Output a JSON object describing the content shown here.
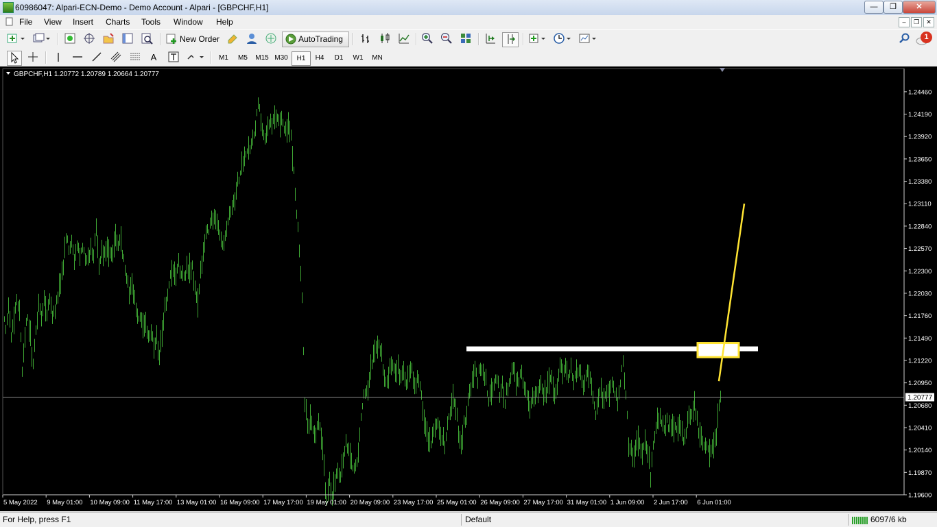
{
  "window": {
    "title": "60986047: Alpari-ECN-Demo - Demo Account - Alpari - [GBPCHF,H1]"
  },
  "menu": [
    "File",
    "View",
    "Insert",
    "Charts",
    "Tools",
    "Window",
    "Help"
  ],
  "toolbar": {
    "new_order_label": "New Order",
    "autotrading_label": "AutoTrading",
    "notification_count": "1"
  },
  "timeframes": {
    "items": [
      "M1",
      "M5",
      "M15",
      "M30",
      "H1",
      "H4",
      "D1",
      "W1",
      "MN"
    ],
    "active": "H1"
  },
  "chart": {
    "info": "GBPCHF,H1  1.20772 1.20789 1.20664 1.20777",
    "current_price_label": "1.20777",
    "price_labels": [
      "1.24460",
      "1.24190",
      "1.23920",
      "1.23650",
      "1.23380",
      "1.23110",
      "1.22840",
      "1.22570",
      "1.22300",
      "1.22030",
      "1.21760",
      "1.21490",
      "1.21220",
      "1.20950",
      "1.20680",
      "1.20410",
      "1.20140",
      "1.19870",
      "1.19600"
    ],
    "time_labels": [
      "5 May 2022",
      "9 May 01:00",
      "10 May 09:00",
      "11 May 17:00",
      "13 May 01:00",
      "16 May 09:00",
      "17 May 17:00",
      "19 May 01:00",
      "20 May 09:00",
      "23 May 17:00",
      "25 May 01:00",
      "26 May 09:00",
      "27 May 17:00",
      "31 May 01:00",
      "1 Jun 09:00",
      "2 Jun 17:00",
      "6 Jun 01:00"
    ],
    "colors": {
      "background": "#000000",
      "bars": "#3fa934",
      "axis_text": "#ffffff",
      "price_line": "#8c8c8c",
      "annotation_horizontal": "#ffffff",
      "annotation_highlight": "#ffe433"
    }
  },
  "chart_data": {
    "type": "ohlc",
    "symbol": "GBPCHF",
    "timeframe": "H1",
    "ylim": [
      1.196,
      1.2474
    ],
    "current_price": 1.20777,
    "price_path": [
      [
        0,
        1.2165
      ],
      [
        4,
        1.2185
      ],
      [
        8,
        1.216
      ],
      [
        12,
        1.219
      ],
      [
        16,
        1.215
      ],
      [
        20,
        1.2175
      ],
      [
        24,
        1.2195
      ],
      [
        28,
        1.2185
      ],
      [
        32,
        1.211
      ],
      [
        36,
        1.2155
      ],
      [
        40,
        1.217
      ],
      [
        44,
        1.215
      ],
      [
        48,
        1.2115
      ],
      [
        52,
        1.216
      ],
      [
        56,
        1.219
      ],
      [
        60,
        1.2175
      ],
      [
        64,
        1.2195
      ],
      [
        68,
        1.218
      ],
      [
        72,
        1.22
      ],
      [
        76,
        1.2175
      ],
      [
        80,
        1.2185
      ],
      [
        84,
        1.22
      ],
      [
        88,
        1.222
      ],
      [
        92,
        1.224
      ],
      [
        96,
        1.227
      ],
      [
        100,
        1.2255
      ],
      [
        104,
        1.2265
      ],
      [
        108,
        1.224
      ],
      [
        112,
        1.226
      ],
      [
        116,
        1.225
      ],
      [
        120,
        1.2265
      ],
      [
        124,
        1.224
      ],
      [
        128,
        1.2245
      ],
      [
        132,
        1.2255
      ],
      [
        136,
        1.225
      ],
      [
        140,
        1.2285
      ],
      [
        144,
        1.223
      ],
      [
        148,
        1.2255
      ],
      [
        152,
        1.2248
      ],
      [
        156,
        1.2262
      ],
      [
        160,
        1.225
      ],
      [
        164,
        1.2258
      ],
      [
        168,
        1.2272
      ],
      [
        172,
        1.2258
      ],
      [
        176,
        1.2268
      ],
      [
        180,
        1.224
      ],
      [
        184,
        1.2225
      ],
      [
        188,
        1.2205
      ],
      [
        192,
        1.2215
      ],
      [
        196,
        1.2195
      ],
      [
        200,
        1.217
      ],
      [
        204,
        1.2175
      ],
      [
        208,
        1.216
      ],
      [
        212,
        1.2168
      ],
      [
        216,
        1.215
      ],
      [
        220,
        1.2155
      ],
      [
        224,
        1.214
      ],
      [
        228,
        1.215
      ],
      [
        232,
        1.2128
      ],
      [
        236,
        1.2155
      ],
      [
        240,
        1.2185
      ],
      [
        244,
        1.22
      ],
      [
        248,
        1.222
      ],
      [
        252,
        1.2225
      ],
      [
        256,
        1.2225
      ],
      [
        260,
        1.2238
      ],
      [
        264,
        1.2222
      ],
      [
        268,
        1.2225
      ],
      [
        272,
        1.2232
      ],
      [
        276,
        1.2228
      ],
      [
        280,
        1.2232
      ],
      [
        284,
        1.221
      ],
      [
        288,
        1.2188
      ],
      [
        292,
        1.2225
      ],
      [
        296,
        1.2258
      ],
      [
        300,
        1.2275
      ],
      [
        304,
        1.228
      ],
      [
        308,
        1.2295
      ],
      [
        312,
        1.2292
      ],
      [
        316,
        1.2285
      ],
      [
        320,
        1.2275
      ],
      [
        324,
        1.226
      ],
      [
        328,
        1.2275
      ],
      [
        332,
        1.2292
      ],
      [
        336,
        1.2305
      ],
      [
        340,
        1.231
      ],
      [
        344,
        1.233
      ],
      [
        348,
        1.2342
      ],
      [
        352,
        1.2358
      ],
      [
        356,
        1.2368
      ],
      [
        360,
        1.2372
      ],
      [
        364,
        1.2378
      ],
      [
        368,
        1.2385
      ],
      [
        372,
        1.2405
      ],
      [
        376,
        1.243
      ],
      [
        380,
        1.2412
      ],
      [
        384,
        1.2398
      ],
      [
        388,
        1.2388
      ],
      [
        392,
        1.2412
      ],
      [
        396,
        1.2405
      ],
      [
        400,
        1.2418
      ],
      [
        404,
        1.2418
      ],
      [
        408,
        1.2412
      ],
      [
        412,
        1.2408
      ],
      [
        416,
        1.2402
      ],
      [
        420,
        1.24
      ],
      [
        424,
        1.239
      ],
      [
        428,
        1.235
      ],
      [
        432,
        1.23
      ],
      [
        436,
        1.226
      ],
      [
        440,
        1.22
      ],
      [
        444,
        1.2065
      ],
      [
        448,
        1.2045
      ],
      [
        452,
        1.205
      ],
      [
        456,
        1.204
      ],
      [
        460,
        1.203
      ],
      [
        464,
        1.2045
      ],
      [
        468,
        1.203
      ],
      [
        472,
        1.199
      ],
      [
        476,
        1.195
      ],
      [
        480,
        1.1975
      ],
      [
        484,
        1.196
      ],
      [
        488,
        1.1975
      ],
      [
        492,
        1.199
      ],
      [
        496,
        1.1985
      ],
      [
        500,
        1.2
      ],
      [
        504,
        1.2025
      ],
      [
        508,
        1.2015
      ],
      [
        512,
        1.2
      ],
      [
        516,
        1.199
      ],
      [
        520,
        1.2005
      ],
      [
        524,
        1.203
      ],
      [
        528,
        1.207
      ],
      [
        532,
        1.2085
      ],
      [
        536,
        1.208
      ],
      [
        540,
        1.2115
      ],
      [
        544,
        1.2125
      ],
      [
        548,
        1.214
      ],
      [
        552,
        1.2145
      ],
      [
        556,
        1.213
      ],
      [
        560,
        1.21
      ],
      [
        564,
        1.2095
      ],
      [
        568,
        1.211
      ],
      [
        572,
        1.212
      ],
      [
        576,
        1.2108
      ],
      [
        580,
        1.2115
      ],
      [
        584,
        1.21
      ],
      [
        588,
        1.2108
      ],
      [
        592,
        1.209
      ],
      [
        596,
        1.2105
      ],
      [
        600,
        1.211
      ],
      [
        604,
        1.2095
      ],
      [
        608,
        1.2098
      ],
      [
        612,
        1.209
      ],
      [
        616,
        1.206
      ],
      [
        620,
        1.204
      ],
      [
        624,
        1.203
      ],
      [
        628,
        1.202
      ],
      [
        632,
        1.2035
      ],
      [
        636,
        1.2045
      ],
      [
        640,
        1.204
      ],
      [
        644,
        1.203
      ],
      [
        648,
        1.2022
      ],
      [
        652,
        1.2045
      ],
      [
        656,
        1.206
      ],
      [
        660,
        1.2075
      ],
      [
        664,
        1.2068
      ],
      [
        668,
        1.204
      ],
      [
        672,
        1.2015
      ],
      [
        676,
        1.2045
      ],
      [
        680,
        1.206
      ],
      [
        684,
        1.2085
      ],
      [
        688,
        1.21
      ],
      [
        692,
        1.211
      ],
      [
        696,
        1.21
      ],
      [
        700,
        1.2115
      ],
      [
        704,
        1.2105
      ],
      [
        708,
        1.2095
      ],
      [
        712,
        1.2075
      ],
      [
        716,
        1.2085
      ],
      [
        720,
        1.2095
      ],
      [
        724,
        1.2105
      ],
      [
        728,
        1.208
      ],
      [
        732,
        1.209
      ],
      [
        736,
        1.2075
      ],
      [
        740,
        1.209
      ],
      [
        744,
        1.21
      ],
      [
        748,
        1.2115
      ],
      [
        752,
        1.2095
      ],
      [
        756,
        1.21
      ],
      [
        760,
        1.211
      ],
      [
        764,
        1.209
      ],
      [
        768,
        1.208
      ],
      [
        772,
        1.206
      ],
      [
        776,
        1.2075
      ],
      [
        780,
        1.2085
      ],
      [
        784,
        1.2085
      ],
      [
        788,
        1.2095
      ],
      [
        792,
        1.2082
      ],
      [
        796,
        1.2085
      ],
      [
        800,
        1.209
      ],
      [
        804,
        1.21
      ],
      [
        808,
        1.208
      ],
      [
        812,
        1.2095
      ],
      [
        816,
        1.212
      ],
      [
        820,
        1.211
      ],
      [
        824,
        1.2118
      ],
      [
        828,
        1.2102
      ],
      [
        832,
        1.2112
      ],
      [
        836,
        1.2098
      ],
      [
        840,
        1.211
      ],
      [
        844,
        1.2112
      ],
      [
        848,
        1.21
      ],
      [
        852,
        1.209
      ],
      [
        856,
        1.2108
      ],
      [
        860,
        1.2095
      ],
      [
        864,
        1.2075
      ],
      [
        868,
        1.206
      ],
      [
        872,
        1.2078
      ],
      [
        876,
        1.2085
      ],
      [
        880,
        1.207
      ],
      [
        884,
        1.2085
      ],
      [
        888,
        1.2082
      ],
      [
        892,
        1.21
      ],
      [
        896,
        1.2085
      ],
      [
        900,
        1.2072
      ],
      [
        904,
        1.2098
      ],
      [
        908,
        1.2115
      ],
      [
        912,
        1.2085
      ],
      [
        916,
        1.2025
      ],
      [
        920,
        1.201
      ],
      [
        924,
        1.2005
      ],
      [
        928,
        1.2025
      ],
      [
        932,
        1.202
      ],
      [
        936,
        1.201
      ],
      [
        940,
        1.202
      ],
      [
        944,
        1.2012
      ],
      [
        948,
        1.1985
      ],
      [
        952,
        1.2015
      ],
      [
        956,
        1.204
      ],
      [
        960,
        1.2055
      ],
      [
        964,
        1.2045
      ],
      [
        968,
        1.204
      ],
      [
        972,
        1.205
      ],
      [
        976,
        1.204
      ],
      [
        980,
        1.2045
      ],
      [
        984,
        1.2042
      ],
      [
        988,
        1.204
      ],
      [
        992,
        1.2042
      ],
      [
        996,
        1.2025
      ],
      [
        1000,
        1.2035
      ],
      [
        1004,
        1.2055
      ],
      [
        1008,
        1.206
      ],
      [
        1012,
        1.207
      ],
      [
        1016,
        1.2045
      ],
      [
        1020,
        1.203
      ],
      [
        1024,
        1.2022
      ],
      [
        1028,
        1.202
      ],
      [
        1032,
        1.2015
      ],
      [
        1036,
        1.2012
      ],
      [
        1040,
        1.2025
      ],
      [
        1044,
        1.203
      ],
      [
        1048,
        1.207
      ],
      [
        1050,
        1.20777
      ]
    ],
    "annotations": [
      {
        "type": "horizontal-line",
        "color": "white",
        "price": 1.2136,
        "x_start": 680,
        "x_end": 1105
      },
      {
        "type": "rectangle",
        "color": "yellow",
        "price_top": 1.2143,
        "price_bottom": 1.2126,
        "x_start": 1017,
        "x_end": 1077
      },
      {
        "type": "trend-line",
        "color": "yellow",
        "x1": 1048,
        "price1": 1.2097,
        "x2": 1085,
        "price2": 1.2311
      }
    ]
  },
  "statusbar": {
    "help": "For Help, press F1",
    "profile": "Default",
    "traffic": "6097/6 kb"
  }
}
